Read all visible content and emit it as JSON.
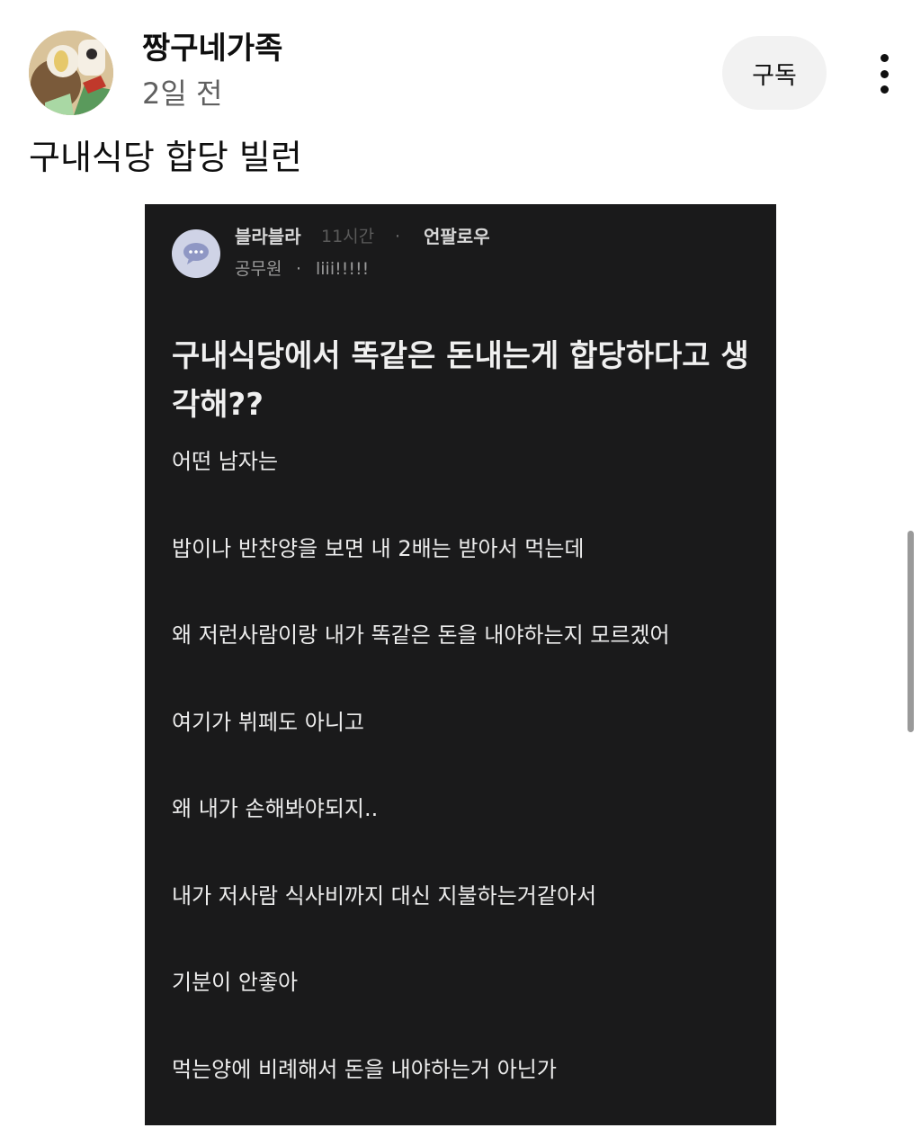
{
  "channel": {
    "name": "짱구네가족",
    "time": "2일 전",
    "subscribe_label": "구독"
  },
  "post": {
    "text": "구내식당 합당 빌런"
  },
  "image": {
    "author": "블라블라",
    "time": "11시간",
    "separator": "·",
    "unfollow": "언팔로우",
    "job": "공무원",
    "nickname": "liii!!!!!",
    "title": "구내식당에서 똑같은 돈내는게 합당하다고 생각해??",
    "lines": [
      "어떤 남자는",
      "밥이나 반찬양을 보면 내 2배는 받아서 먹는데",
      "왜 저런사람이랑 내가 똑같은 돈을 내야하는지 모르겠어",
      "여기가 뷔페도 아니고",
      "왜 내가 손해봐야되지..",
      "내가 저사람 식사비까지 대신 지불하는거같아서",
      "기분이 안좋아",
      "먹는양에 비례해서 돈을 내야하는거 아닌가"
    ]
  }
}
